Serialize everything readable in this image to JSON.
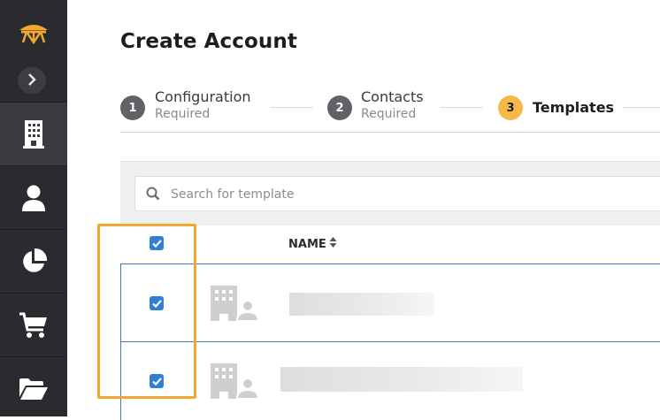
{
  "page": {
    "title": "Create Account"
  },
  "sidebar": {
    "items": [
      {
        "icon": "building-icon",
        "active": true
      },
      {
        "icon": "user-icon",
        "active": false
      },
      {
        "icon": "pie-chart-icon",
        "active": false
      },
      {
        "icon": "cart-icon",
        "active": false
      },
      {
        "icon": "folder-open-icon",
        "active": false
      }
    ]
  },
  "stepper": {
    "steps": [
      {
        "number": "1",
        "title": "Configuration",
        "subtitle": "Required"
      },
      {
        "number": "2",
        "title": "Contacts",
        "subtitle": "Required"
      },
      {
        "number": "3",
        "title": "Templates"
      }
    ]
  },
  "search": {
    "placeholder": "Search for template"
  },
  "table": {
    "columns": {
      "name": "NAME"
    },
    "select_all_checked": true,
    "rows": [
      {
        "checked": true,
        "icon": "building-user-icon"
      },
      {
        "checked": true,
        "icon": "building-user-icon"
      }
    ]
  },
  "colors": {
    "sidebar_bg": "#2a2b2f",
    "accent": "#f7b84a",
    "checkbox": "#2f7fd9",
    "highlight": "#f0a830"
  }
}
